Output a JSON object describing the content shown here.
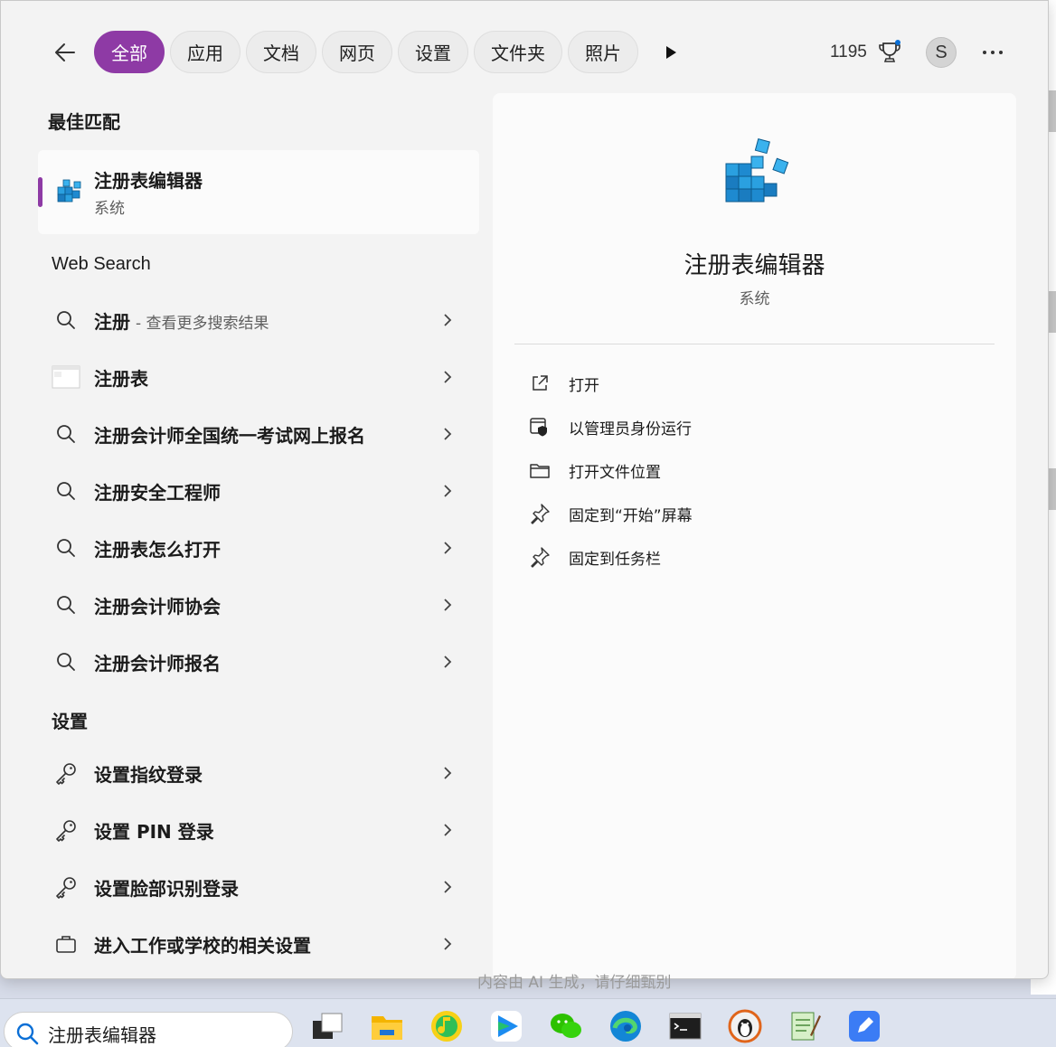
{
  "filters": {
    "back_label": "",
    "items": [
      "全部",
      "应用",
      "文档",
      "网页",
      "设置",
      "文件夹",
      "照片"
    ],
    "active_index": 0
  },
  "header": {
    "points": "1195",
    "avatar_letter": "S"
  },
  "best_match": {
    "section_title": "最佳匹配",
    "title": "注册表编辑器",
    "subtitle": "系统"
  },
  "web_search": {
    "section_title": "Web Search",
    "items": [
      {
        "label": "注册",
        "suffix": "- 查看更多搜索结果",
        "icon": "search-icon"
      },
      {
        "label": "注册表",
        "suffix": "",
        "icon": "webpage-thumbnail-icon"
      },
      {
        "label": "注册会计师全国统一考试网上报名",
        "suffix": "",
        "icon": "search-icon"
      },
      {
        "label": "注册安全工程师",
        "suffix": "",
        "icon": "search-icon"
      },
      {
        "label": "注册表怎么打开",
        "suffix": "",
        "icon": "search-icon"
      },
      {
        "label": "注册会计师协会",
        "suffix": "",
        "icon": "search-icon"
      },
      {
        "label": "注册会计师报名",
        "suffix": "",
        "icon": "search-icon"
      }
    ]
  },
  "settings": {
    "section_title": "设置",
    "items": [
      {
        "label": "设置指纹登录",
        "icon": "key-icon"
      },
      {
        "label": "设置 PIN 登录",
        "icon": "key-icon"
      },
      {
        "label": "设置脸部识别登录",
        "icon": "key-icon"
      },
      {
        "label": "进入工作或学校的相关设置",
        "icon": "briefcase-icon"
      }
    ]
  },
  "preview": {
    "title": "注册表编辑器",
    "subtitle": "系统",
    "actions": [
      {
        "label": "打开",
        "icon": "open-external-icon"
      },
      {
        "label": "以管理员身份运行",
        "icon": "shield-admin-icon"
      },
      {
        "label": "打开文件位置",
        "icon": "folder-icon"
      },
      {
        "label": "固定到“开始”屏幕",
        "icon": "pin-icon"
      },
      {
        "label": "固定到任务栏",
        "icon": "pin-icon"
      }
    ]
  },
  "caption": "内容由 AI 生成，请仔细甄别",
  "taskbar": {
    "search_text": "注册表编辑器",
    "apps": [
      "task-view-icon",
      "file-explorer-icon",
      "music-app-icon",
      "video-player-icon",
      "wechat-icon",
      "edge-browser-icon",
      "terminal-icon",
      "penguin-app-icon",
      "notepad-icon",
      "editor-app-icon"
    ]
  },
  "colors": {
    "accent": "#8e3aa5",
    "panel_bg": "#f3f3f3",
    "card_bg": "#fbfbfb",
    "regedit_blue": "#1e90d6"
  }
}
